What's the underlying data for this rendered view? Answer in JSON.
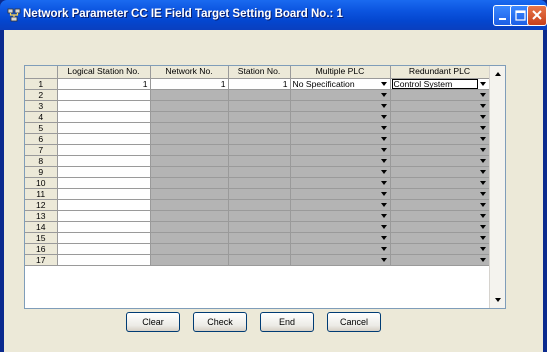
{
  "window": {
    "title": "Network Parameter CC IE Field Target Setting Board No.: 1",
    "title_icon": "network-app-icon",
    "controls": [
      "minimize-icon",
      "maximize-icon",
      "close-icon"
    ]
  },
  "grid": {
    "headers": [
      "",
      "Logical Station No.",
      "Network No.",
      "Station No.",
      "Multiple PLC",
      "Redundant PLC"
    ],
    "rows": [
      {
        "num": "1",
        "logical": "1",
        "network": "1",
        "station": "1",
        "multiple": "No Specification",
        "redundant": "Control System"
      },
      {
        "num": "2",
        "logical": "",
        "network": "",
        "station": "",
        "multiple": "",
        "redundant": ""
      },
      {
        "num": "3",
        "logical": "",
        "network": "",
        "station": "",
        "multiple": "",
        "redundant": ""
      },
      {
        "num": "4",
        "logical": "",
        "network": "",
        "station": "",
        "multiple": "",
        "redundant": ""
      },
      {
        "num": "5",
        "logical": "",
        "network": "",
        "station": "",
        "multiple": "",
        "redundant": ""
      },
      {
        "num": "6",
        "logical": "",
        "network": "",
        "station": "",
        "multiple": "",
        "redundant": ""
      },
      {
        "num": "7",
        "logical": "",
        "network": "",
        "station": "",
        "multiple": "",
        "redundant": ""
      },
      {
        "num": "8",
        "logical": "",
        "network": "",
        "station": "",
        "multiple": "",
        "redundant": ""
      },
      {
        "num": "9",
        "logical": "",
        "network": "",
        "station": "",
        "multiple": "",
        "redundant": ""
      },
      {
        "num": "10",
        "logical": "",
        "network": "",
        "station": "",
        "multiple": "",
        "redundant": ""
      },
      {
        "num": "11",
        "logical": "",
        "network": "",
        "station": "",
        "multiple": "",
        "redundant": ""
      },
      {
        "num": "12",
        "logical": "",
        "network": "",
        "station": "",
        "multiple": "",
        "redundant": ""
      },
      {
        "num": "13",
        "logical": "",
        "network": "",
        "station": "",
        "multiple": "",
        "redundant": ""
      },
      {
        "num": "14",
        "logical": "",
        "network": "",
        "station": "",
        "multiple": "",
        "redundant": ""
      },
      {
        "num": "15",
        "logical": "",
        "network": "",
        "station": "",
        "multiple": "",
        "redundant": ""
      },
      {
        "num": "16",
        "logical": "",
        "network": "",
        "station": "",
        "multiple": "",
        "redundant": ""
      },
      {
        "num": "17",
        "logical": "",
        "network": "",
        "station": "",
        "multiple": "",
        "redundant": ""
      }
    ]
  },
  "buttons": {
    "clear": "Clear",
    "check": "Check",
    "end": "End",
    "cancel": "Cancel"
  },
  "colors": {
    "titlebar": "#0c55e0",
    "client_bg": "#ece9d8",
    "disabled_cell": "#b4b4b4"
  }
}
